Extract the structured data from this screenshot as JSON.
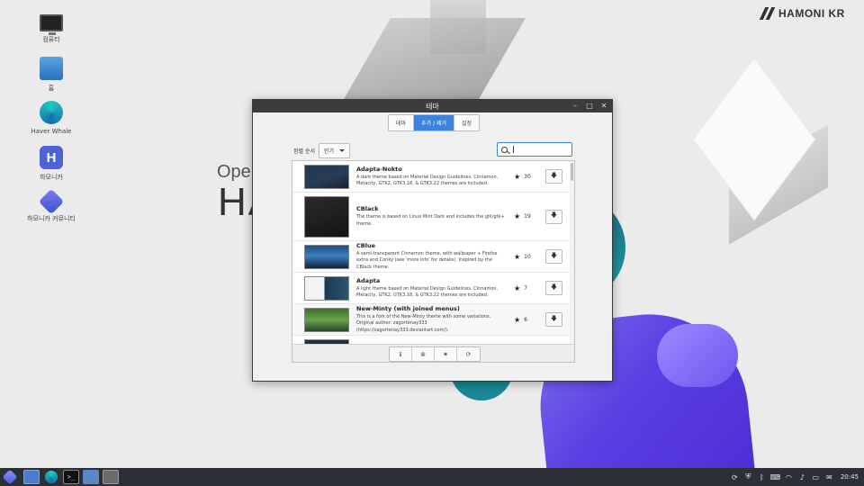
{
  "brand": {
    "logo_text": "HAMONI KR"
  },
  "background": {
    "open_text": "Oper",
    "big_text": "HA"
  },
  "desktop_icons": [
    {
      "label": "컴퓨터"
    },
    {
      "label": "홈"
    },
    {
      "label": "Haver Whale"
    },
    {
      "label": "하모니카"
    },
    {
      "label": "하모니카 커뮤니티"
    }
  ],
  "window": {
    "title": "테마",
    "controls": {
      "minimize": "–",
      "maximize": "□",
      "close": "✕"
    },
    "tabs": [
      {
        "label": "테마",
        "active": false
      },
      {
        "label": "추가 / 제거",
        "active": true
      },
      {
        "label": "설정",
        "active": false
      }
    ],
    "sort": {
      "label": "정렬 순서",
      "value": "인기"
    },
    "search": {
      "value": "",
      "placeholder": ""
    },
    "themes": [
      {
        "name": "Adapta-Nokto",
        "description": "A dark theme based on Material Design Guidelines. Cinnamon, Metacity, GTK2, GTK3.18, & GTK3.22 themes are included.",
        "stars": "30",
        "thumb": "dark"
      },
      {
        "name": "CBlack",
        "description": "The theme is based on Linux Mint Dark and includes the gtk/gtk+ theme.",
        "stars": "19",
        "thumb": "black"
      },
      {
        "name": "CBlue",
        "description": "A semi-transparent Cinnamon theme, with wallpaper + Firefox extra and Conky (see 'more info' for details). Inspired by the CBlack theme.",
        "stars": "10",
        "thumb": "blue"
      },
      {
        "name": "Adapta",
        "description": "A light theme based on Material Design Guidelines. Cinnamon, Metacity, GTK2, GTK3.18, & GTK3.22 themes are included.",
        "stars": "7",
        "thumb": "light"
      },
      {
        "name": "New-Minty (with joined menus)",
        "description": "This is a fork of the New-Minty theme with some variations. Original author: zagortenay333 (https://zagortenay333.deviantart.com/).",
        "stars": "6",
        "thumb": "mint"
      }
    ],
    "download_icon": "download-arrow-icon",
    "bottom_buttons": [
      {
        "icon": "info-icon",
        "glyph": "ℹ"
      },
      {
        "icon": "remove-icon",
        "glyph": "⊗"
      },
      {
        "icon": "settings-icon",
        "glyph": "✷"
      },
      {
        "icon": "refresh-icon",
        "glyph": "⟳"
      }
    ]
  },
  "taskbar": {
    "clock": "20:45",
    "items": [
      "start-menu-icon",
      "show-desktop-icon",
      "whale-browser-icon",
      "terminal-icon",
      "files-icon",
      "theme-app-icon"
    ],
    "tray": [
      "updates-icon",
      "shield-icon",
      "bluetooth-icon",
      "keyboard-icon",
      "network-icon",
      "volume-icon",
      "battery-icon",
      "message-icon"
    ]
  },
  "colors": {
    "accent": "#3b83dd",
    "titlebar": "#3c3c3c",
    "taskbar": "#2c2f36"
  }
}
